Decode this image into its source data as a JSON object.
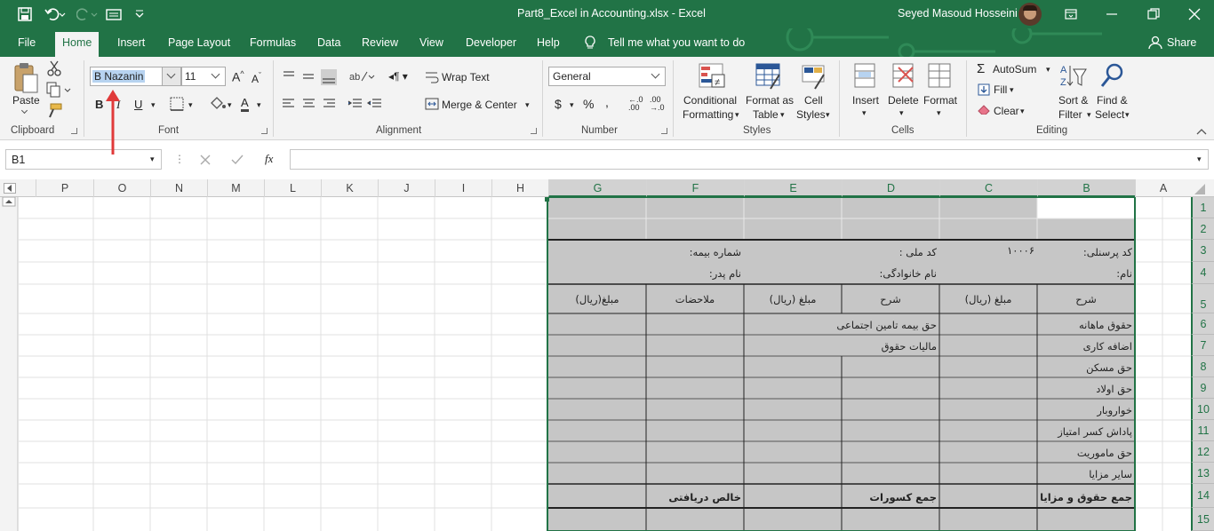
{
  "window": {
    "title": "Part8_Excel in Accounting.xlsx  -  Excel",
    "user": "Seyed Masoud Hosseini"
  },
  "tabs": [
    "File",
    "Home",
    "Insert",
    "Page Layout",
    "Formulas",
    "Data",
    "Review",
    "View",
    "Developer",
    "Help"
  ],
  "tell_me": "Tell me what you want to do",
  "share": "Share",
  "ribbon": {
    "clipboard": {
      "label": "Clipboard",
      "paste": "Paste"
    },
    "font": {
      "label": "Font",
      "name": "B Nazanin",
      "size": "11"
    },
    "alignment": {
      "label": "Alignment",
      "wrap": "Wrap Text",
      "merge": "Merge & Center"
    },
    "number": {
      "label": "Number",
      "format": "General"
    },
    "styles": {
      "label": "Styles",
      "cond1": "Conditional",
      "cond2": "Formatting",
      "fmt1": "Format as",
      "fmt2": "Table",
      "cell1": "Cell",
      "cell2": "Styles"
    },
    "cells": {
      "label": "Cells",
      "insert": "Insert",
      "delete": "Delete",
      "format": "Format"
    },
    "editing": {
      "label": "Editing",
      "autosum": "AutoSum",
      "fill": "Fill",
      "clear": "Clear",
      "sort1": "Sort &",
      "sort2": "Filter",
      "find1": "Find &",
      "find2": "Select"
    }
  },
  "namebox": "B1",
  "fx": "fx",
  "columns": [
    "P",
    "O",
    "N",
    "M",
    "L",
    "K",
    "J",
    "I",
    "H",
    "G",
    "F",
    "E",
    "D",
    "C",
    "B",
    "A"
  ],
  "rows": [
    "1",
    "2",
    "3",
    "4",
    "5",
    "6",
    "7",
    "8",
    "9",
    "10",
    "11",
    "12",
    "13",
    "14",
    "15"
  ],
  "sheet": {
    "personnel_label": "کد پرسنلی:",
    "personnel_value": "۱۰۰۰۶",
    "national_label": "کد ملی :",
    "insurance_label": "شماره بیمه:",
    "name_label": "نام:",
    "family_label": "نام خانوادگی:",
    "father_label": "نام پدر:",
    "h_desc1": "شرح",
    "h_amount1": "مبلغ (ریال)",
    "h_desc2": "شرح",
    "h_amount2": "مبلغ (ریال)",
    "h_notes": "ملاحضات",
    "h_amount3": "مبلغ(ریال)",
    "items": [
      "حقوق ماهانه",
      "اضافه کاری",
      "حق مسکن",
      "حق اولاد",
      "خواروبار",
      "پاداش  کسر امتیاز",
      "حق ماموریت",
      "سایر مزایا"
    ],
    "ded1": "حق بیمه  تامین اجتماعی",
    "ded2": "مالیات حقوق",
    "total_benefits": "جمع حقوق و مزایا",
    "total_deductions": "جمع کسورات",
    "net": "خالص دریافتی"
  },
  "colors": {
    "excel_green": "#217346",
    "sheet_gray": "#c6c6c6",
    "arrow_red": "#e03a3a"
  }
}
